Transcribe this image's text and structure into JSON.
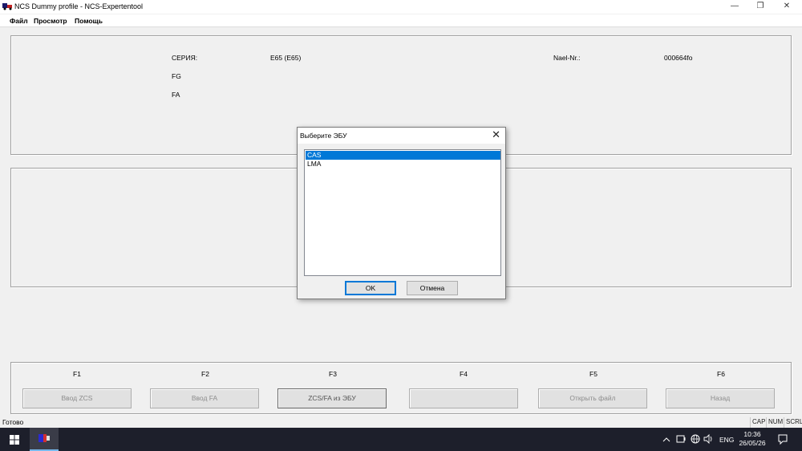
{
  "window": {
    "title": "NCS Dummy profile - NCS-Expertentool",
    "minimize": "—",
    "restore": "❐",
    "close": "✕"
  },
  "menu": [
    "Файл",
    "Просмотр",
    "Помощь"
  ],
  "info": {
    "series_label": "СЕРИЯ:",
    "series_value": "E65 (E65)",
    "fg_label": "FG",
    "fa_label": "FA",
    "nael_label": "Nael-Nr.:",
    "nael_value": "000664fo"
  },
  "fkeys": [
    {
      "key": "F1",
      "label": "Ввод ZCS"
    },
    {
      "key": "F2",
      "label": "Ввод FA"
    },
    {
      "key": "F3",
      "label": "ZCS/FA из ЭБУ"
    },
    {
      "key": "F4",
      "label": ""
    },
    {
      "key": "F5",
      "label": "Открыть файл"
    },
    {
      "key": "F6",
      "label": "Назад"
    }
  ],
  "status": {
    "text": "Готово",
    "indicators": [
      "CAP",
      "NUM",
      "SCRL"
    ]
  },
  "dialog": {
    "title": "Выберите ЭБУ",
    "close": "✕",
    "items": [
      "CAS",
      "LMA"
    ],
    "selected_index": 0,
    "ok_label": "OK",
    "cancel_label": "Отмена"
  },
  "taskbar": {
    "language": "ENG",
    "time": "10:36",
    "date": "26/05/26"
  },
  "colors": {
    "selection": "#0078d7",
    "taskbar": "#1d1f2b"
  }
}
